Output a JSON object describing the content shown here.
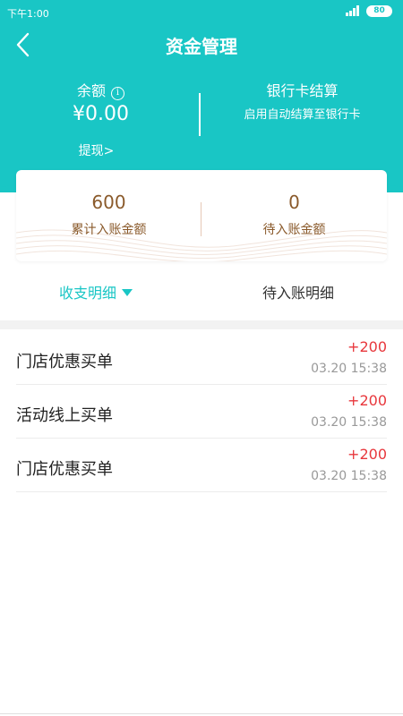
{
  "status_bar": {
    "time": "下午1:00",
    "battery": "80"
  },
  "nav": {
    "title": "资金管理"
  },
  "balance": {
    "label": "余额",
    "value": "¥0.00",
    "withdraw": "提现>"
  },
  "bank": {
    "title": "银行卡结算",
    "subtitle": "启用自动结算至银行卡"
  },
  "stats": [
    {
      "value": "600",
      "label": "累计入账金额"
    },
    {
      "value": "0",
      "label": "待入账金额"
    }
  ],
  "tabs": [
    {
      "label": "收支明细"
    },
    {
      "label": "待入账明细"
    }
  ],
  "transactions": [
    {
      "name": "门店优惠买单",
      "amount": "+200",
      "time": "03.20 15:38"
    },
    {
      "name": "活动线上买单",
      "amount": "+200",
      "time": "03.20 15:38"
    },
    {
      "name": "门店优惠买单",
      "amount": "+200",
      "time": "03.20 15:38"
    }
  ],
  "colors": {
    "accent": "#19c6c5",
    "amount": "#e8373c",
    "stat_text": "#8a5a2b"
  }
}
